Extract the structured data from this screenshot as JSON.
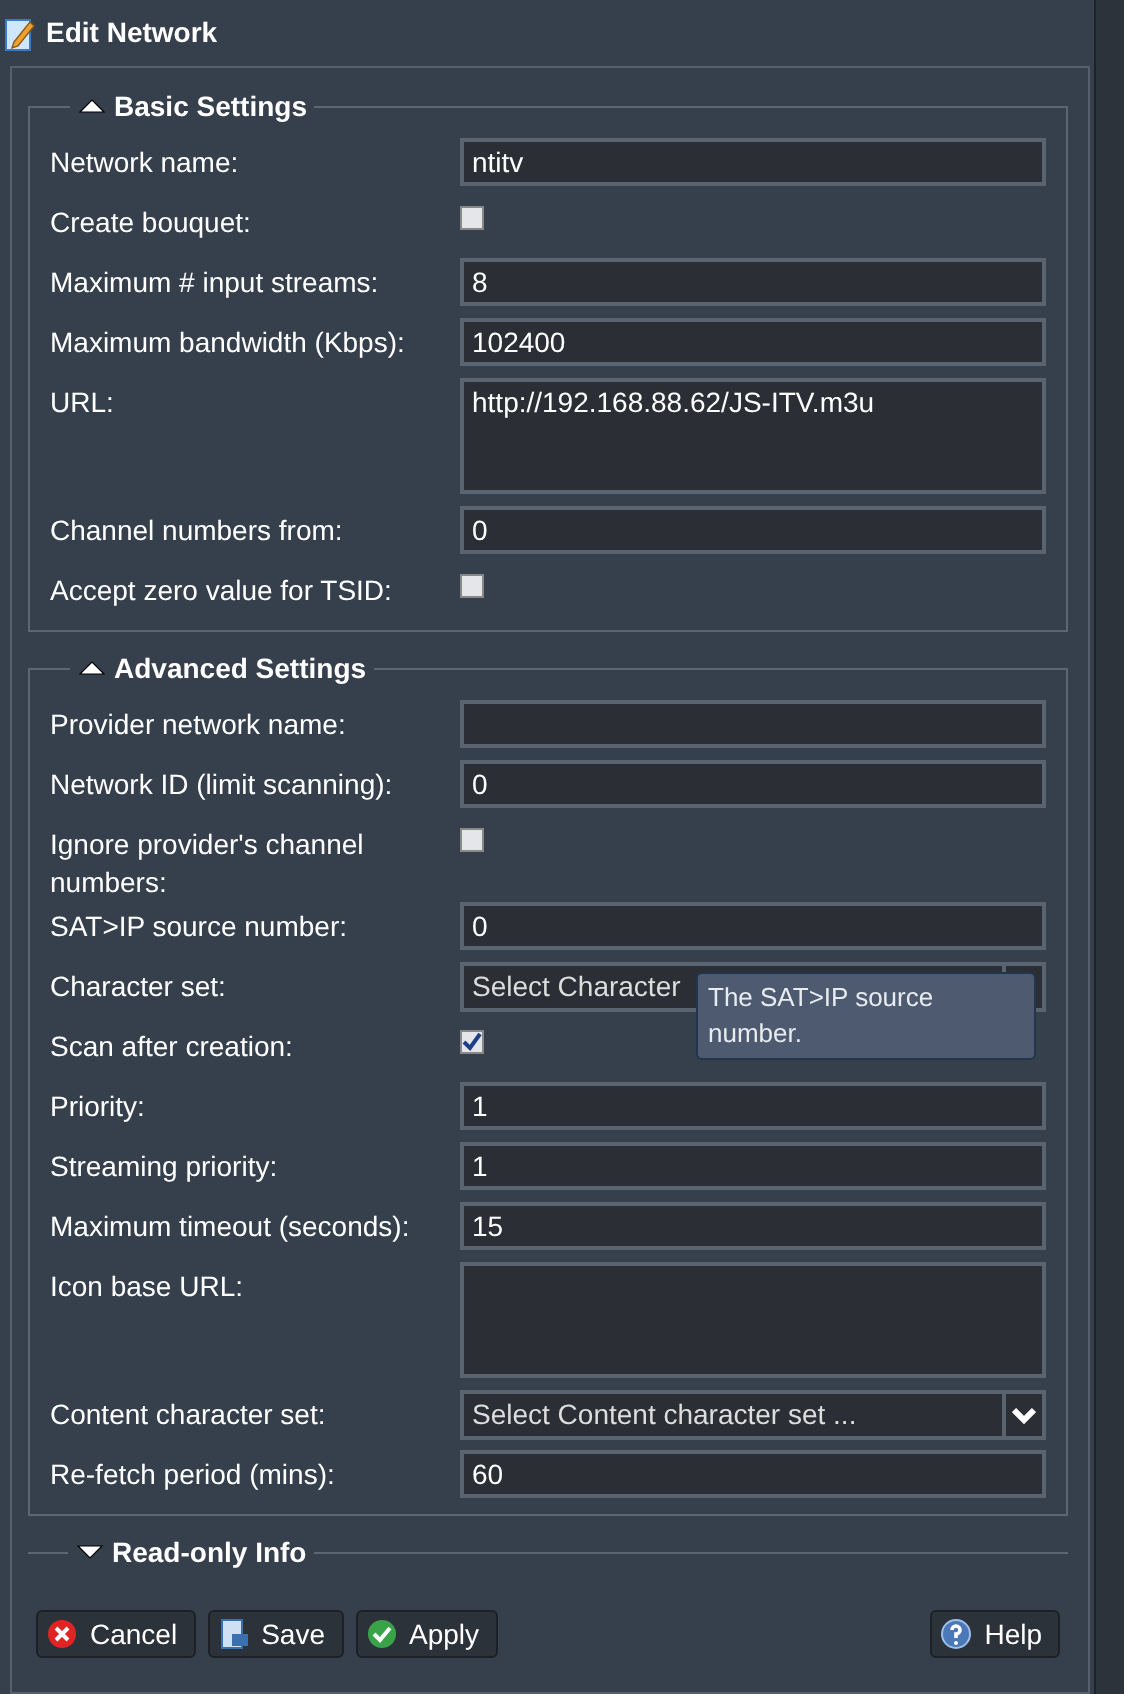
{
  "window": {
    "title": "Edit Network"
  },
  "sections": [
    {
      "title": "Basic Settings",
      "expanded": true,
      "fields": [
        {
          "label": "Network name:",
          "kind": "text",
          "value": "ntitv"
        },
        {
          "label": "Create bouquet:",
          "kind": "checkbox",
          "checked": false
        },
        {
          "label": "Maximum # input streams:",
          "kind": "text",
          "value": "8"
        },
        {
          "label": "Maximum bandwidth (Kbps):",
          "kind": "text",
          "value": "102400"
        },
        {
          "label": "URL:",
          "kind": "textarea",
          "value": "http://192.168.88.62/JS-ITV.m3u"
        },
        {
          "label": "Channel numbers from:",
          "kind": "text",
          "value": "0"
        },
        {
          "label": "Accept zero value for TSID:",
          "kind": "checkbox",
          "checked": false
        }
      ]
    },
    {
      "title": "Advanced Settings",
      "expanded": true,
      "fields": [
        {
          "label": "Provider network name:",
          "kind": "text"
        },
        {
          "label": "Network ID (limit scanning):",
          "kind": "text",
          "value": "0"
        },
        {
          "label": "Ignore provider's channel numbers:",
          "kind": "checkbox",
          "checked": false
        },
        {
          "label": "SAT>IP source number:",
          "kind": "text",
          "value": "0"
        },
        {
          "label": "Character set:",
          "kind": "select",
          "placeholder": "Select Character",
          "tooltip": "The SAT>IP source number."
        },
        {
          "label": "Scan after creation:",
          "kind": "checkbox",
          "checked": true
        },
        {
          "label": "Priority:",
          "kind": "text",
          "value": "1"
        },
        {
          "label": "Streaming priority:",
          "kind": "text",
          "value": "1"
        },
        {
          "label": "Maximum timeout (seconds):",
          "kind": "text",
          "value": "15"
        },
        {
          "label": "Icon base URL:",
          "kind": "textarea"
        },
        {
          "label": "Content character set:",
          "kind": "select",
          "placeholder": "Select Content character set ..."
        },
        {
          "label": "Re-fetch period (mins):",
          "kind": "text",
          "value": "60"
        }
      ]
    },
    {
      "title": "Read-only Info",
      "expanded": false
    }
  ],
  "buttons": [
    {
      "label": "Cancel",
      "kind": "cancel"
    },
    {
      "label": "Save",
      "kind": "save"
    },
    {
      "label": "Apply",
      "kind": "apply"
    },
    {
      "label": "Help",
      "kind": "help"
    }
  ]
}
